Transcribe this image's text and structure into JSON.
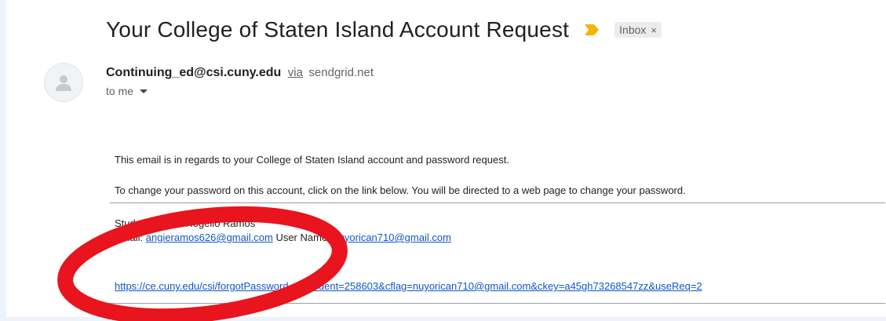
{
  "email": {
    "subject": "Your College of Staten Island Account Request",
    "label": "Inbox",
    "label_remove": "×",
    "sender": "Continuing_ed@csi.cuny.edu",
    "via": "via",
    "via_domain": "sendgrid.net",
    "to": "to me"
  },
  "message": {
    "line1": "This email is in regards to your College of Staten Island account and password request.",
    "line2": "To change your password on this account, click on the link below. You will be directed to a web page to change your password.",
    "student_name_label": "Student Name:",
    "student_name": "Rogelio Ramos",
    "email_label": "Email:",
    "email_value": "angieramos626@gmail.com",
    "user_name_label": "User Name:",
    "user_name_value": "nuyorican710@gmail.com",
    "reset_link": "https://ce.cuny.edu/csi/forgotPassword.cfm?cdent=258603&cflag=nuyorican710@gmail.com&ckey=a45gh73268547zz&useReq=2"
  },
  "colors": {
    "link": "#1155cc",
    "importance_marker": "#f4b400",
    "annotation_circle": "#e8141e"
  },
  "icons": [
    "importance-marker-icon",
    "avatar-person-icon",
    "chevron-down-icon"
  ]
}
